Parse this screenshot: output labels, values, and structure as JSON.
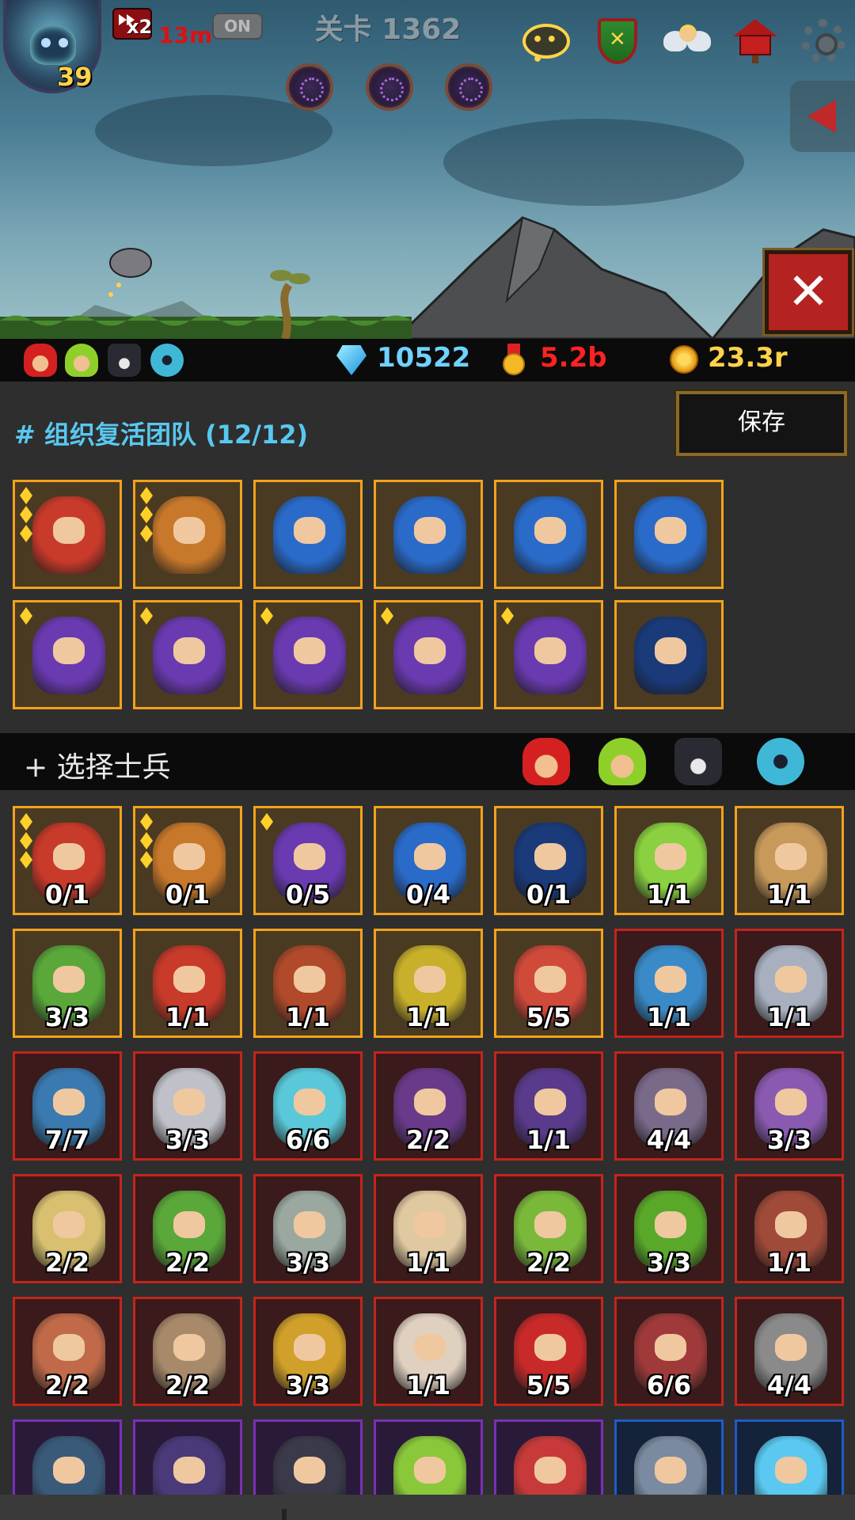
{
  "hud": {
    "player_level": "39",
    "speed_multiplier": "x2",
    "speed_time": "13m",
    "auto_toggle": "ON",
    "stage_title": "关卡 1362",
    "top_icons": [
      "chat-icon",
      "guild-shield-icon",
      "angel-icon",
      "mailbox-icon",
      "gear-icon"
    ],
    "close_label": "✕"
  },
  "resources": {
    "factions": [
      "red-faction-icon",
      "green-faction-icon",
      "dark-faction-icon",
      "blue-faction-icon"
    ],
    "diamond": "10522",
    "medal": "5.2b",
    "gold": "23.3r"
  },
  "team": {
    "title": "# 组织复活团队 (12/12)",
    "save_label": "保存",
    "slots": [
      {
        "unit": "red-armored-knight",
        "stars": 3,
        "color": "#c83a2a"
      },
      {
        "unit": "drill-rider",
        "stars": 3,
        "color": "#c8782a"
      },
      {
        "unit": "white-horned-knight",
        "stars": 0,
        "color": "#2a6ac8"
      },
      {
        "unit": "white-horned-knight",
        "stars": 0,
        "color": "#2a6ac8"
      },
      {
        "unit": "white-horned-knight",
        "stars": 0,
        "color": "#2a6ac8"
      },
      {
        "unit": "white-horned-knight",
        "stars": 0,
        "color": "#2a6ac8"
      },
      {
        "unit": "purple-hooded-archer",
        "stars": 1,
        "color": "#6a3ab0"
      },
      {
        "unit": "purple-hooded-archer",
        "stars": 1,
        "color": "#6a3ab0"
      },
      {
        "unit": "purple-hooded-archer",
        "stars": 1,
        "color": "#6a3ab0"
      },
      {
        "unit": "purple-hooded-archer",
        "stars": 1,
        "color": "#6a3ab0"
      },
      {
        "unit": "purple-hooded-archer",
        "stars": 1,
        "color": "#6a3ab0"
      },
      {
        "unit": "blue-samurai-mage",
        "stars": 0,
        "color": "#1a3a7a"
      }
    ]
  },
  "select": {
    "title": "+ 选择士兵",
    "filters": [
      "red-faction-filter-icon",
      "green-faction-filter-icon",
      "dark-faction-filter-icon",
      "blue-faction-filter-icon"
    ]
  },
  "roster": [
    {
      "count": "0/1",
      "stars": 3,
      "frame": "gold",
      "color": "#c83a2a"
    },
    {
      "count": "0/1",
      "stars": 3,
      "frame": "gold",
      "color": "#c8782a"
    },
    {
      "count": "0/5",
      "stars": 1,
      "frame": "gold",
      "color": "#6a3ab0"
    },
    {
      "count": "0/4",
      "stars": 0,
      "frame": "gold",
      "color": "#2a6ac8"
    },
    {
      "count": "0/1",
      "stars": 0,
      "frame": "gold",
      "color": "#1a3a7a"
    },
    {
      "count": "1/1",
      "stars": 0,
      "frame": "gold",
      "color": "#8ad040"
    },
    {
      "count": "1/1",
      "stars": 0,
      "frame": "gold",
      "color": "#c89a5a"
    },
    {
      "count": "3/3",
      "stars": 0,
      "frame": "gold",
      "color": "#5aa83a"
    },
    {
      "count": "1/1",
      "stars": 0,
      "frame": "gold",
      "color": "#c83a2a"
    },
    {
      "count": "1/1",
      "stars": 0,
      "frame": "gold",
      "color": "#b04a2a"
    },
    {
      "count": "1/1",
      "stars": 0,
      "frame": "gold",
      "color": "#c8b02a"
    },
    {
      "count": "5/5",
      "stars": 0,
      "frame": "gold",
      "color": "#d04a3a"
    },
    {
      "count": "1/1",
      "stars": 0,
      "frame": "red",
      "color": "#3a8ac8"
    },
    {
      "count": "1/1",
      "stars": 0,
      "frame": "red",
      "color": "#a8b0c0"
    },
    {
      "count": "7/7",
      "stars": 0,
      "frame": "red",
      "color": "#3a7ab0"
    },
    {
      "count": "3/3",
      "stars": 0,
      "frame": "red",
      "color": "#c0c0c8"
    },
    {
      "count": "6/6",
      "stars": 0,
      "frame": "red",
      "color": "#5ac8d8"
    },
    {
      "count": "2/2",
      "stars": 0,
      "frame": "red",
      "color": "#6a3a8a"
    },
    {
      "count": "1/1",
      "stars": 0,
      "frame": "red",
      "color": "#5a3a8a"
    },
    {
      "count": "4/4",
      "stars": 0,
      "frame": "red",
      "color": "#7a6a8a"
    },
    {
      "count": "3/3",
      "stars": 0,
      "frame": "red",
      "color": "#8a5ab0"
    },
    {
      "count": "2/2",
      "stars": 0,
      "frame": "red",
      "color": "#d8c070"
    },
    {
      "count": "2/2",
      "stars": 0,
      "frame": "red",
      "color": "#5aa83a"
    },
    {
      "count": "3/3",
      "stars": 0,
      "frame": "red",
      "color": "#9aa8a0"
    },
    {
      "count": "1/1",
      "stars": 0,
      "frame": "red",
      "color": "#e0c8a0"
    },
    {
      "count": "2/2",
      "stars": 0,
      "frame": "red",
      "color": "#7ab83a"
    },
    {
      "count": "3/3",
      "stars": 0,
      "frame": "red",
      "color": "#5aa82a"
    },
    {
      "count": "1/1",
      "stars": 0,
      "frame": "red",
      "color": "#a04a3a"
    },
    {
      "count": "2/2",
      "stars": 0,
      "frame": "red",
      "color": "#c06a4a"
    },
    {
      "count": "2/2",
      "stars": 0,
      "frame": "red",
      "color": "#a88a6a"
    },
    {
      "count": "3/3",
      "stars": 0,
      "frame": "red",
      "color": "#d0a02a"
    },
    {
      "count": "1/1",
      "stars": 0,
      "frame": "red",
      "color": "#e0d0c0"
    },
    {
      "count": "5/5",
      "stars": 0,
      "frame": "red",
      "color": "#c82a2a"
    },
    {
      "count": "6/6",
      "stars": 0,
      "frame": "red",
      "color": "#a03a3a"
    },
    {
      "count": "4/4",
      "stars": 0,
      "frame": "red",
      "color": "#8a8a8a"
    },
    {
      "count": "",
      "stars": 0,
      "frame": "purple",
      "color": "#3a5a7a"
    },
    {
      "count": "",
      "stars": 0,
      "frame": "purple",
      "color": "#4a3a7a"
    },
    {
      "count": "",
      "stars": 0,
      "frame": "purple",
      "color": "#3a3a4a"
    },
    {
      "count": "",
      "stars": 0,
      "frame": "purple",
      "color": "#8ac83a"
    },
    {
      "count": "",
      "stars": 0,
      "frame": "purple",
      "color": "#c83a3a"
    },
    {
      "count": "",
      "stars": 0,
      "frame": "blue",
      "color": "#7a8aa0"
    },
    {
      "count": "",
      "stars": 0,
      "frame": "blue",
      "color": "#5ac8f0"
    }
  ]
}
